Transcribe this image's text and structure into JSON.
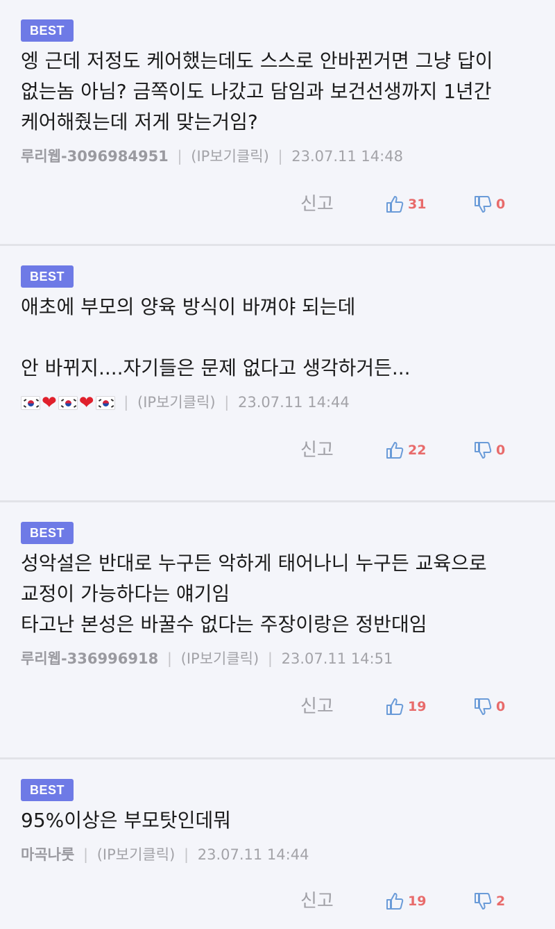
{
  "badge_label": "BEST",
  "report_label": "신고",
  "meta_separator": "|",
  "comments": [
    {
      "text": "엥 근데 저정도 케어했는데도 스스로 안바뀐거면 그냥 답이 없는놈 아님? 금쪽이도 나갔고 담임과 보건선생까지 1년간 케어해줬는데 저게 맞는거임?",
      "author": "루리웹-3096984951",
      "ip": "(IP보기클릭)",
      "timestamp": "23.07.11 14:48",
      "likes": "31",
      "dislikes": "0"
    },
    {
      "text": "애초에 부모의 양육 방식이 바껴야 되는데\n\n안 바뀌지....자기들은 문제 없다고 생각하거든...",
      "author_emoji": [
        "korea-flag",
        "red-heart",
        "korea-flag",
        "red-heart",
        "korea-flag"
      ],
      "ip": "(IP보기클릭)",
      "timestamp": "23.07.11 14:44",
      "likes": "22",
      "dislikes": "0"
    },
    {
      "text": "성악설은 반대로 누구든 악하게 태어나니 누구든 교육으로 교정이 가능하다는 얘기임\n타고난 본성은 바꿀수 없다는 주장이랑은 정반대임",
      "author": "루리웹-336996918",
      "ip": "(IP보기클릭)",
      "timestamp": "23.07.11 14:51",
      "likes": "19",
      "dislikes": "0"
    },
    {
      "text": "95%이상은 부모탓인데뭐",
      "author": "마곡나룻",
      "ip": "(IP보기클릭)",
      "timestamp": "23.07.11 14:44",
      "likes": "19",
      "dislikes": "2"
    }
  ],
  "colors": {
    "badge": "#6e7ae6",
    "like_icon": "#6a9bd8",
    "count": "#e86b6b",
    "background": "#f4f5fa",
    "divider": "#e2e3e8"
  }
}
